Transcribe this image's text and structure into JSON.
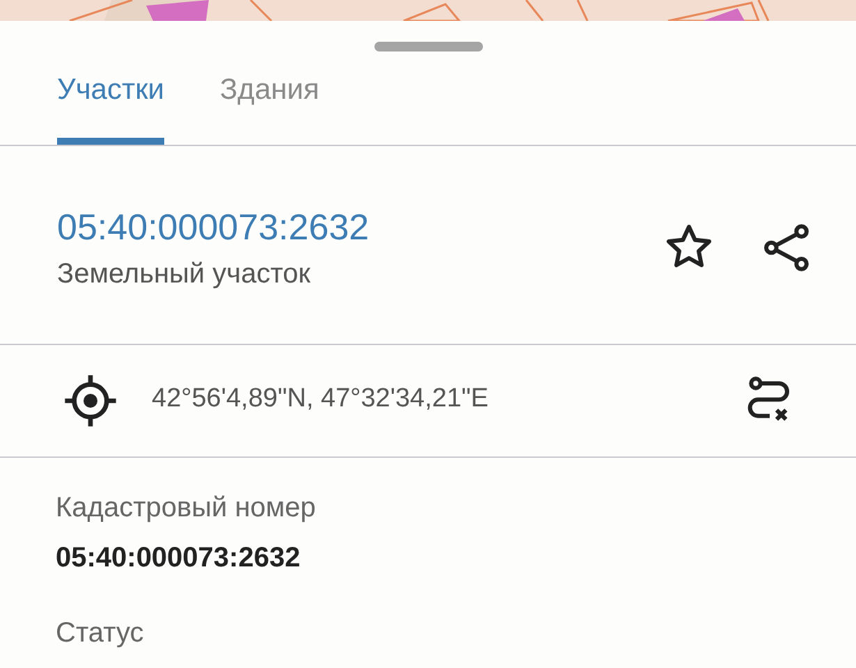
{
  "tabs": [
    {
      "label": "Участки",
      "selected": true
    },
    {
      "label": "Здания",
      "selected": false
    }
  ],
  "parcel": {
    "number": "05:40:000073:2632",
    "type": "Земельный участок"
  },
  "location": {
    "coordinates": "42°56'4,89\"N, 47°32'34,21\"E"
  },
  "details": [
    {
      "label": "Кадастровый номер",
      "value": "05:40:000073:2632"
    },
    {
      "label": "Статус"
    }
  ]
}
